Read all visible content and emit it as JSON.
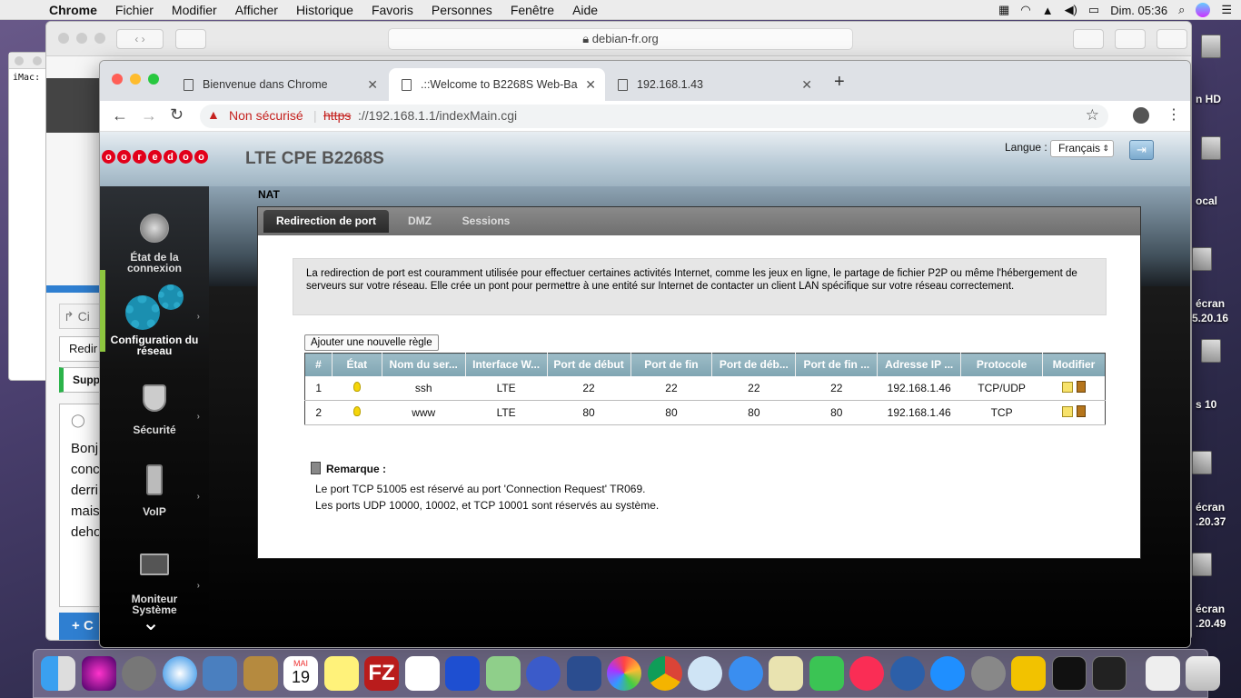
{
  "menubar": {
    "app": "Chrome",
    "items": [
      "Fichier",
      "Modifier",
      "Afficher",
      "Historique",
      "Favoris",
      "Personnes",
      "Fenêtre",
      "Aide"
    ],
    "clock": "Dim. 05:36"
  },
  "desktop": {
    "labels": [
      "n HD",
      "ocal",
      "écran",
      "5.20.16",
      "s 10",
      "écran",
      ".20.37",
      "écran",
      ".20.49"
    ]
  },
  "back_window": {
    "url": "debian-fr.org",
    "terminal_text": "iMac:",
    "sidebar_fragments": [
      "Ci",
      "Redir",
      "Supp",
      "Bonj",
      "conc",
      "derri",
      "mais",
      "deho",
      "C"
    ]
  },
  "tabs": [
    {
      "title": "Bienvenue dans Chrome"
    },
    {
      "title": ".::Welcome to B2268S Web-Ba"
    },
    {
      "title": "192.168.1.43"
    }
  ],
  "address": {
    "security": "Non sécurisé",
    "scheme": "https",
    "rest": "://192.168.1.1/indexMain.cgi"
  },
  "router": {
    "logo": [
      "o",
      "o",
      "r",
      "e",
      "d",
      "o",
      "o"
    ],
    "product": "LTE CPE B2268S",
    "lang_label": "Langue :",
    "lang_value": "Français",
    "sidebar": [
      {
        "label": "État de la connexion"
      },
      {
        "label": "Configuration du réseau"
      },
      {
        "label": "Sécurité"
      },
      {
        "label": "VoIP"
      },
      {
        "label": "Moniteur Système"
      }
    ],
    "section_title": "NAT",
    "subtabs": [
      "Redirection de port",
      "DMZ",
      "Sessions"
    ],
    "info": "La redirection de port est couramment utilisée pour effectuer certaines activités Internet, comme les jeux en ligne, le partage de fichier P2P ou même l'hébergement de serveurs sur votre réseau. Elle crée un pont pour permettre à une entité sur Internet de contacter un client LAN spécifique sur votre réseau correctement.",
    "add_rule": "Ajouter une nouvelle règle",
    "columns": [
      "#",
      "État",
      "Nom du ser...",
      "Interface W...",
      "Port de début",
      "Port de fin",
      "Port de déb...",
      "Port de fin ...",
      "Adresse IP ...",
      "Protocole",
      "Modifier"
    ],
    "rows": [
      [
        "1",
        "",
        "ssh",
        "LTE",
        "22",
        "22",
        "22",
        "22",
        "192.168.1.46",
        "TCP/UDP"
      ],
      [
        "2",
        "",
        "www",
        "LTE",
        "80",
        "80",
        "80",
        "80",
        "192.168.1.46",
        "TCP"
      ]
    ],
    "remark_title": "Remarque :",
    "remarks": [
      "Le port TCP 51005 est réservé au port 'Connection Request' TR069.",
      "Les ports UDP 10000, 10002, et TCP 10001 sont réservés au système."
    ]
  },
  "dock": {
    "calendar_month": "MAI",
    "calendar_day": "19"
  }
}
